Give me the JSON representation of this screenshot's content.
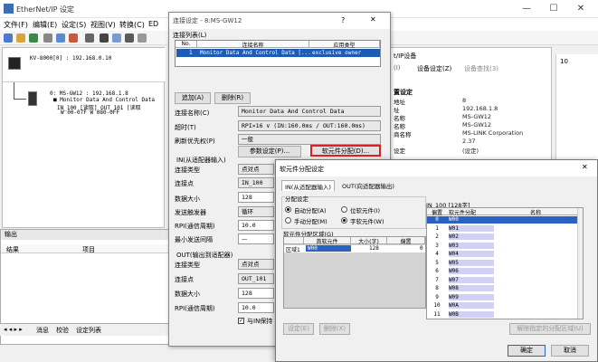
{
  "main_window": {
    "title": "EtherNet/IP 设定",
    "menu": [
      "文件(F)",
      "编辑(E)",
      "设定(S)",
      "视图(V)",
      "转换(C)",
      "ED"
    ],
    "win_buttons": {
      "minimize": "—",
      "maximize": "☐",
      "close": "✕"
    }
  },
  "network": {
    "master": "KV-8000[0] : 192.168.0.10",
    "device_lines": [
      "0: MS-GW12 : 192.168.1.8",
      "■ Monitor Data And Control Data",
      "IN_100 [读取]    OUT_101 [读取",
      "W  00-07F        W  080-0FF"
    ]
  },
  "output_panel": {
    "title": "输出",
    "col_result": "结果",
    "col_item": "项目",
    "tabs": [
      "消息",
      "校验",
      "设定列表"
    ]
  },
  "props_panel": {
    "header": "t/IP设备",
    "tab1": "(I)",
    "tab2": "设备设定(Z)",
    "tab3": "设备查找(3)",
    "section": "置设定",
    "rows": [
      {
        "k": "地址",
        "v": "8"
      },
      {
        "k": "址",
        "v": "192.168.1.8"
      },
      {
        "k": "名称",
        "v": "MS-GW12"
      },
      {
        "k": "名称",
        "v": "MS-GW12"
      },
      {
        "k": "商名称",
        "v": "MS-LINK Corporation"
      },
      {
        "k": "",
        "v": "2.37"
      },
      {
        "k": "设定",
        "v": "(设定)"
      }
    ],
    "right_value": "10"
  },
  "conn_dialog": {
    "title": "连接设定 - 8:MS-GW12",
    "help": "?",
    "close": "✕",
    "list_label": "连接列表(L)",
    "col_no": "No.",
    "col_name": "连接名称",
    "col_type": "应用类型",
    "row_no": "1",
    "row_name": "Monitor Data And Control Data [...",
    "row_type": "exclusive owner",
    "btn_add": "追加(A)",
    "btn_delete": "删除(R)",
    "lbl_conn_name": "连接名称(C)",
    "val_conn_name": "Monitor Data And Control Data",
    "lbl_timeout": "超时(T)",
    "val_timeout": "RPI×16  ∨ (IN:160.0ms / OUT:160.0ms)",
    "lbl_priority": "刷新优先权(P)",
    "val_priority": "一般",
    "btn_params": "参数设定(P)...",
    "btn_assign": "软元件分配(D)...",
    "in_section": "IN(从适配器输入)",
    "in_rows": [
      {
        "label": "连接类型",
        "value": "点对点"
      },
      {
        "label": "连接点",
        "value": "IN_100"
      },
      {
        "label": "数据大小",
        "value": "128"
      },
      {
        "label": "发送触发器",
        "value": "循环"
      },
      {
        "label": "RPI(通信周期)",
        "value": "10.0"
      },
      {
        "label": "最小发送间隔",
        "value": "—"
      }
    ],
    "out_section": "OUT(输出到适配器)",
    "out_rows": [
      {
        "label": "连接类型",
        "value": "点对点"
      },
      {
        "label": "连接点",
        "value": "OUT_101"
      },
      {
        "label": "数据大小",
        "value": "128"
      },
      {
        "label": "RPI(通信周期)",
        "value": "10.0"
      }
    ],
    "check_label": "与IN保持"
  },
  "assign_dialog": {
    "title": "软元件分配设定",
    "close": "✕",
    "tab_in": "IN(从适配器输入)",
    "tab_out": "OUT(向适配器输出)",
    "group_label": "分配设定",
    "radio_auto": "自动分配(A)",
    "radio_bit": "位软元件(I)",
    "radio_manual": "手动分配(M)",
    "radio_word": "字软元件(W)",
    "area_label": "软元件分配区域(G)",
    "area_col1": "首软元件",
    "area_col2": "大小(字)",
    "area_col3": "偏置",
    "area_row_name": "区域1",
    "area_row_dev": "W00",
    "area_row_size": "128",
    "area_row_offset": "0",
    "map_title": "IN_100 [128字]",
    "map_col1": "偏置",
    "map_col2": "软元件分配",
    "map_col3": "名称",
    "map_rows": [
      {
        "off": "0",
        "dev": "W00"
      },
      {
        "off": "1",
        "dev": "W01"
      },
      {
        "off": "2",
        "dev": "W02"
      },
      {
        "off": "3",
        "dev": "W03"
      },
      {
        "off": "4",
        "dev": "W04"
      },
      {
        "off": "5",
        "dev": "W05"
      },
      {
        "off": "6",
        "dev": "W06"
      },
      {
        "off": "7",
        "dev": "W07"
      },
      {
        "off": "8",
        "dev": "W08"
      },
      {
        "off": "9",
        "dev": "W09"
      },
      {
        "off": "10",
        "dev": "W0A"
      },
      {
        "off": "11",
        "dev": "W0B"
      }
    ],
    "btn_set": "设定(E)",
    "btn_del": "删除(X)",
    "btn_release": "解除指定的分配区域(U)",
    "btn_ok": "确定",
    "btn_cancel": "取消"
  }
}
